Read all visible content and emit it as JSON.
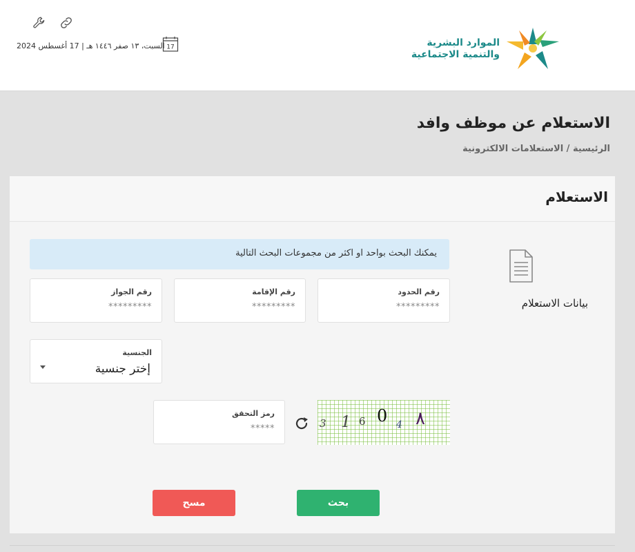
{
  "header": {
    "date_text": "السبت، ١٣ صفر ١٤٤٦ هـ | 17 أغسطس 2024",
    "calendar_day": "17",
    "logo": {
      "line1": "الموارد البشرية",
      "line2": "والتنمية الاجتماعية"
    },
    "icons": [
      "wrench-icon",
      "link-icon",
      "calendar-icon"
    ]
  },
  "page": {
    "title": "الاستعلام عن موظف وافد",
    "breadcrumb": "الرئيسية / الاستعلامات الالكترونية"
  },
  "card": {
    "title": "الاستعلام",
    "side_label": "بيانات الاستعلام",
    "info_text": "يمكنك البحث بواحد او اكثر من مجموعات البحث التالية",
    "fields": {
      "border_number": {
        "label": "رقم الحدود",
        "value": "*********"
      },
      "iqama_number": {
        "label": "رقم الإقامة",
        "value": "*********"
      },
      "passport_number": {
        "label": "رقم الجواز",
        "value": "*********"
      },
      "nationality": {
        "label": "الجنسية",
        "value": "إختر جنسية"
      },
      "captcha_code": {
        "label": "رمز التحقق",
        "value": "*****"
      }
    },
    "captcha_chars": [
      "3",
      "1",
      "6",
      "0",
      "4",
      "٨"
    ],
    "buttons": {
      "search": "بحث",
      "clear": "مسح"
    }
  },
  "colors": {
    "primary_green": "#2fb270",
    "danger_red": "#f05956",
    "info_bg": "#d8ebf8",
    "logo_teal": "#1c8a89"
  }
}
